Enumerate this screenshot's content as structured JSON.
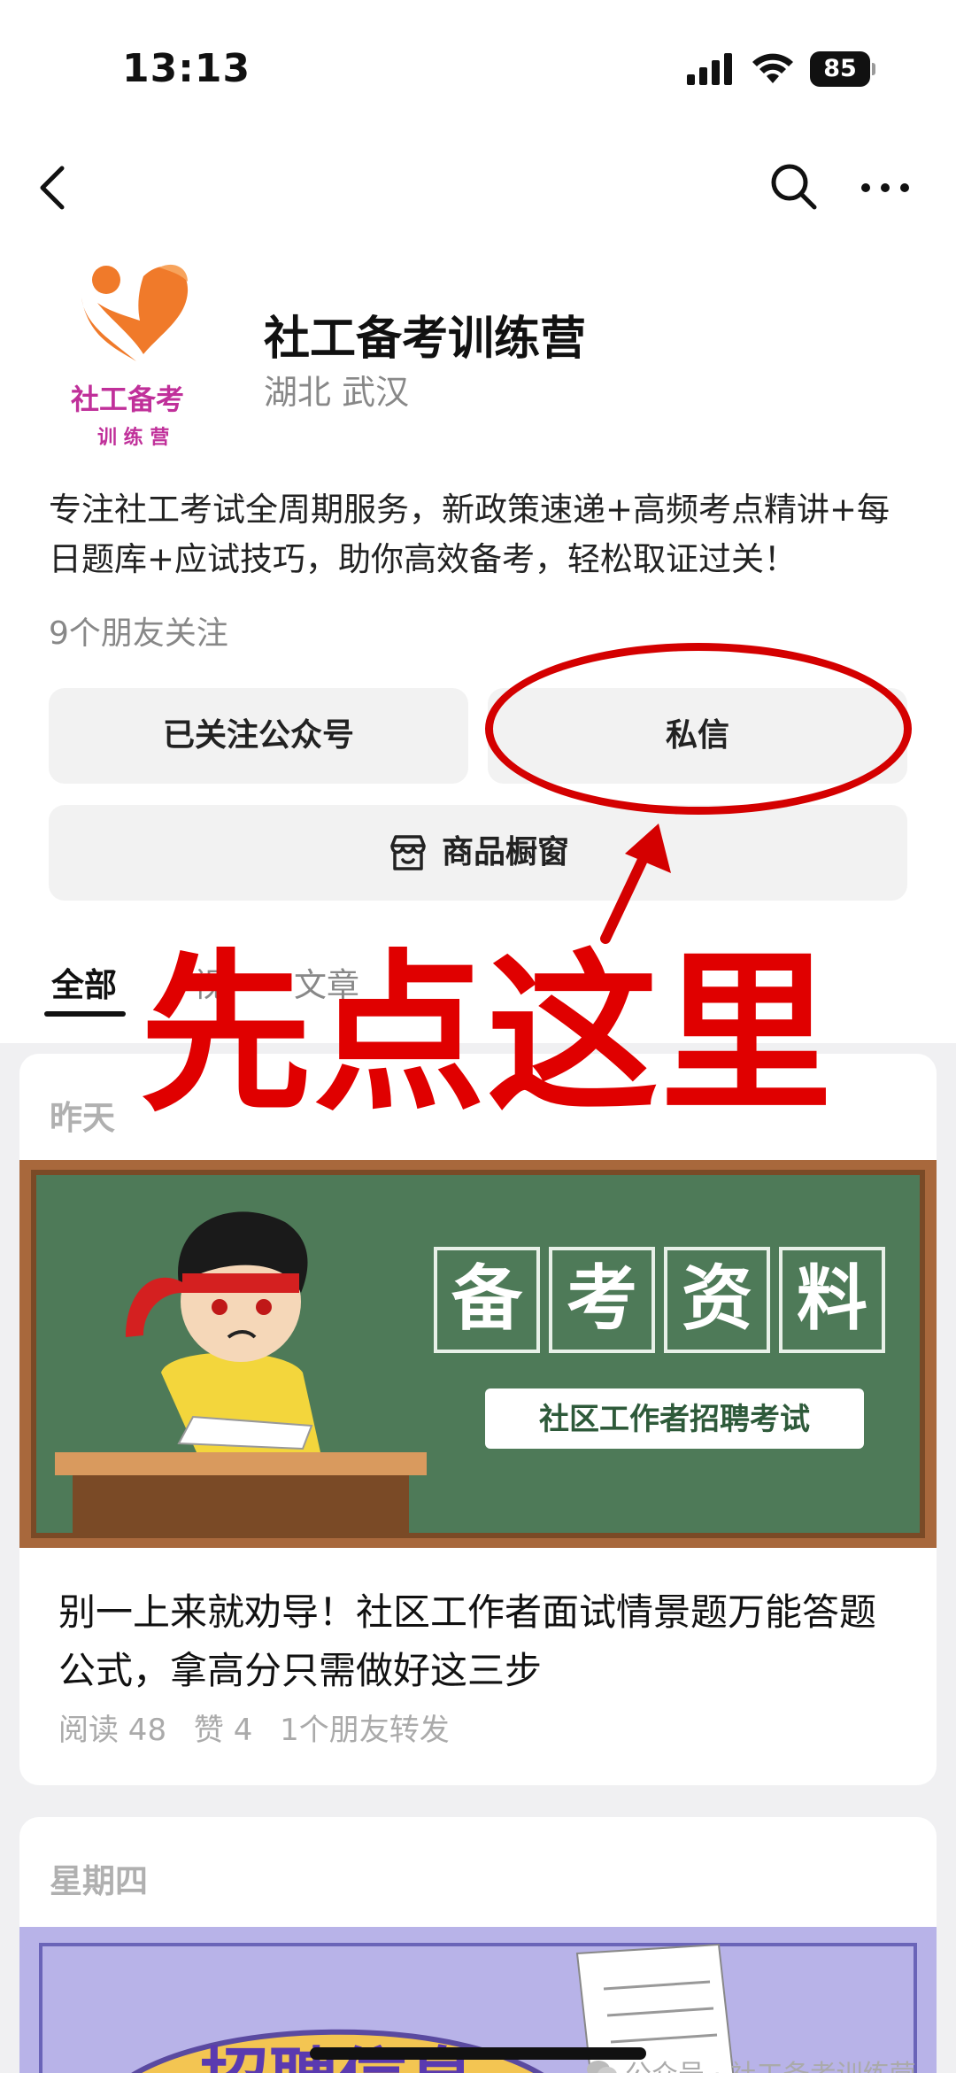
{
  "status_bar": {
    "time": "13:13",
    "battery": "85"
  },
  "profile": {
    "logo_text_1": "社工备考",
    "logo_text_2": "训 练 营",
    "name": "社工备考训练营",
    "location": "湖北 武汉",
    "description": "专注社工考试全周期服务，新政策速递+高频考点精讲+每日题库+应试技巧，助你高效备考，轻松取证过关！",
    "friends_following": "9个朋友关注"
  },
  "buttons": {
    "follow": "已关注公众号",
    "message": "私信",
    "shop": "商品橱窗"
  },
  "tabs": {
    "all": "全部",
    "video": "视",
    "article": "文章"
  },
  "annotation": {
    "text": "先点这里",
    "color": "#e00000"
  },
  "feed": {
    "post_1": {
      "date": "昨天",
      "cover_title": [
        "备",
        "考",
        "资",
        "料"
      ],
      "cover_subtitle": "社区工作者招聘考试",
      "title": "别一上来就劝导！社区工作者面试情景题万能答题公式，拿高分只需做好这三步",
      "reads": "阅读 48",
      "likes": "赞 4",
      "shares": "1个朋友转发"
    },
    "post_2": {
      "date": "星期四",
      "cover_title": "招聘信息"
    }
  },
  "watermark": "公众号 · 社工备考训练营",
  "colors": {
    "accent_red": "#d40000",
    "logo_orange": "#f07a2a",
    "logo_magenta": "#c0309a",
    "board_green": "#4e7a58"
  }
}
